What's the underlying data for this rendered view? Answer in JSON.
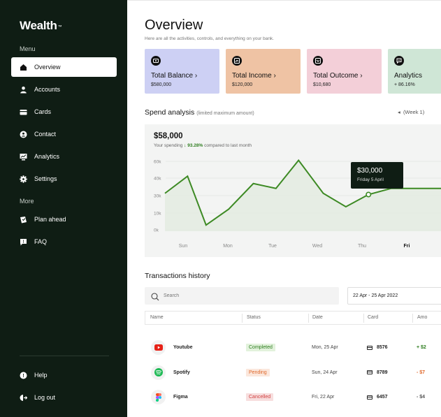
{
  "sidebar": {
    "brand": "Wealth",
    "brand_mark": "™",
    "menu_label": "Menu",
    "more_label": "More",
    "menu_items": [
      {
        "label": "Overview",
        "icon": "home-icon",
        "active": true
      },
      {
        "label": "Accounts",
        "icon": "user-icon",
        "active": false
      },
      {
        "label": "Cards",
        "icon": "card-icon",
        "active": false
      },
      {
        "label": "Contact",
        "icon": "contact-icon",
        "active": false
      },
      {
        "label": "Analytics",
        "icon": "analytics-icon",
        "active": false
      },
      {
        "label": "Settings",
        "icon": "gear-icon",
        "active": false
      }
    ],
    "more_items": [
      {
        "label": "Plan ahead",
        "icon": "plan-icon"
      },
      {
        "label": "FAQ",
        "icon": "faq-icon"
      }
    ],
    "bottom_items": [
      {
        "label": "Help",
        "icon": "help-icon"
      },
      {
        "label": "Log out",
        "icon": "logout-icon"
      }
    ]
  },
  "header": {
    "title": "Overview",
    "subtitle": "Here are all the activities, controls, and everything on your bank."
  },
  "cards": [
    {
      "title": "Total Balance",
      "arrow": "›",
      "value": "$580,000",
      "color": "#cdd0f4",
      "icon": "balance-icon"
    },
    {
      "title": "Total Income",
      "arrow": "›",
      "value": "$120,000",
      "color": "#efc3a4",
      "icon": "income-icon"
    },
    {
      "title": "Total Outcome",
      "arrow": "›",
      "value": "$10,680",
      "color": "#f3cfd8",
      "icon": "outcome-icon"
    },
    {
      "title": "Analytics",
      "arrow": "",
      "value": "+ 86.16%",
      "color": "#cfe6d6",
      "icon": "analytics-card-icon"
    }
  ],
  "spend": {
    "title": "Spend analysis",
    "limit_note": "(limited maximum amount)",
    "week_label": "(Week 1)",
    "week_arrow": "◂",
    "total": "$58,000",
    "note_prefix": "Your spending",
    "note_arrow": "↓",
    "note_pct": "93.28%",
    "note_suffix": "compared to last month",
    "tooltip_value": "$30,000",
    "tooltip_date": "Friday 5 April"
  },
  "chart_data": {
    "type": "line",
    "x": [
      "Sun",
      "Mon",
      "Tue",
      "Wed",
      "Thu",
      "Fri"
    ],
    "y_ticks": [
      "60k",
      "40k",
      "30k",
      "10k",
      "0k"
    ],
    "series": [
      {
        "points": [
          {
            "x": 0.0,
            "y": 31
          },
          {
            "x": 0.55,
            "y": 45
          },
          {
            "x": 1.0,
            "y": 5
          },
          {
            "x": 1.55,
            "y": 18
          },
          {
            "x": 2.15,
            "y": 39
          },
          {
            "x": 2.7,
            "y": 35
          },
          {
            "x": 3.25,
            "y": 58
          },
          {
            "x": 3.85,
            "y": 31
          },
          {
            "x": 4.4,
            "y": 20
          },
          {
            "x": 4.95,
            "y": 30
          },
          {
            "x": 5.5,
            "y": 35
          }
        ]
      }
    ],
    "highlight_index": 9,
    "line_color": "#3d8a24",
    "ylim": [
      0,
      60
    ]
  },
  "transactions": {
    "title": "Transactions history",
    "search_placeholder": "Search",
    "date_range": "22 Apr - 25 Apr 2022",
    "columns": [
      "Name",
      "Status",
      "Date",
      "Card",
      "Amo"
    ],
    "rows": [
      {
        "name": "Youtube",
        "status": "Completed",
        "status_type": "completed",
        "date": "Mon, 25 Apr",
        "card": "8576",
        "amount": "+ $2",
        "amount_type": "pos",
        "logo": "youtube-logo-icon"
      },
      {
        "name": "Spotify",
        "status": "Pending",
        "status_type": "pending",
        "date": "Sun, 24 Apr",
        "card": "8789",
        "amount": "- $7",
        "amount_type": "neg",
        "logo": "spotify-logo-icon"
      },
      {
        "name": "Figma",
        "status": "Cancelled",
        "status_type": "cancelled",
        "date": "Fri, 22 Apr",
        "card": "6457",
        "amount": "- $4",
        "amount_type": "neutral",
        "logo": "figma-logo-icon"
      }
    ]
  }
}
